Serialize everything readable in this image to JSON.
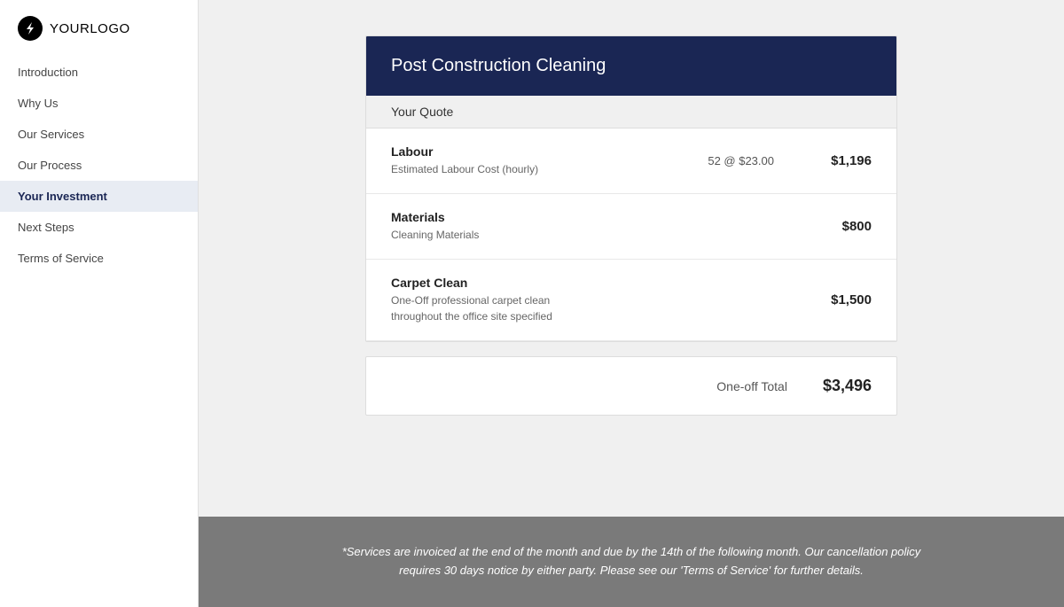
{
  "logo": {
    "icon_label": "lightning-bolt",
    "text_bold": "YOUR",
    "text_regular": "LOGO"
  },
  "sidebar": {
    "items": [
      {
        "id": "introduction",
        "label": "Introduction",
        "active": false
      },
      {
        "id": "why-us",
        "label": "Why Us",
        "active": false
      },
      {
        "id": "our-services",
        "label": "Our Services",
        "active": false
      },
      {
        "id": "our-process",
        "label": "Our Process",
        "active": false
      },
      {
        "id": "your-investment",
        "label": "Your Investment",
        "active": true
      },
      {
        "id": "next-steps",
        "label": "Next Steps",
        "active": false
      },
      {
        "id": "terms-of-service",
        "label": "Terms of Service",
        "active": false
      }
    ]
  },
  "quote": {
    "header_title": "Post Construction Cleaning",
    "section_header": "Your Quote",
    "rows": [
      {
        "id": "labour",
        "title": "Labour",
        "description": "Estimated Labour Cost (hourly)",
        "meta": "52 @ $23.00",
        "amount": "$1,196"
      },
      {
        "id": "materials",
        "title": "Materials",
        "description": "Cleaning Materials",
        "meta": "",
        "amount": "$800"
      },
      {
        "id": "carpet-clean",
        "title": "Carpet Clean",
        "description": "One-Off professional carpet clean\nthroughout the office site specified",
        "meta": "",
        "amount": "$1,500"
      }
    ],
    "total_label": "One-off Total",
    "total_amount": "$3,496"
  },
  "footer": {
    "text": "*Services are invoiced at the end of the month and due by the 14th of the following month. Our cancellation policy requires 30 days notice by either party. Please see our 'Terms of Service' for further details."
  }
}
